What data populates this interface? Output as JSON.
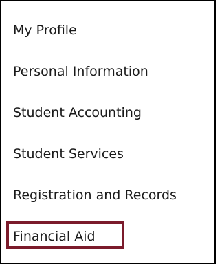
{
  "menu": {
    "items": [
      {
        "label": "My Profile"
      },
      {
        "label": "Personal Information"
      },
      {
        "label": "Student Accounting"
      },
      {
        "label": "Student Services"
      },
      {
        "label": "Registration and Records"
      },
      {
        "label": "Financial Aid"
      }
    ],
    "highlighted_item": "Financial Aid"
  },
  "colors": {
    "highlight_border": "#7b1b2b",
    "panel_border": "#000000",
    "text": "#1a1a1a"
  }
}
